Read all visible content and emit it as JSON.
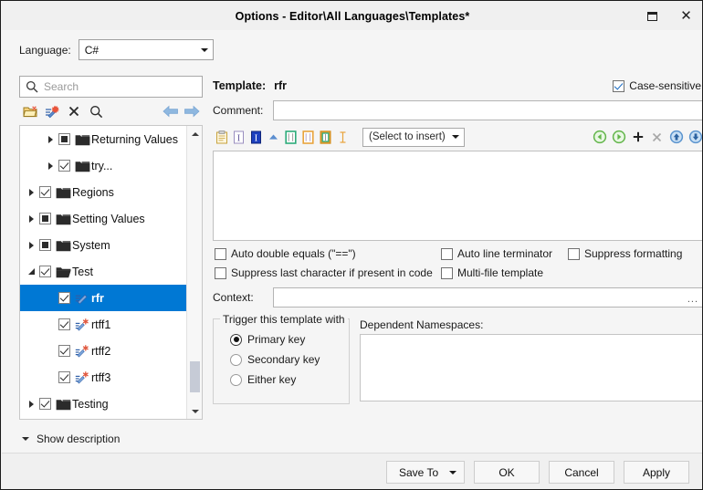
{
  "window": {
    "title": "Options - Editor\\All Languages\\Templates*",
    "restore_icon": "restore-icon",
    "close_icon": "close-icon"
  },
  "language": {
    "label": "Language:",
    "value": "C#"
  },
  "search": {
    "placeholder": "Search",
    "icon": "search-icon"
  },
  "tree_toolbar": {
    "buttons": [
      {
        "name": "new-folder-icon",
        "tooltip": "New folder"
      },
      {
        "name": "new-template-icon",
        "tooltip": "New template"
      },
      {
        "name": "delete-icon",
        "tooltip": "Delete"
      },
      {
        "name": "find-icon",
        "tooltip": "Find"
      }
    ],
    "nav": [
      {
        "name": "back-arrow-icon"
      },
      {
        "name": "forward-arrow-icon"
      }
    ]
  },
  "tree": {
    "items": [
      {
        "label": "Returning Values",
        "indent": 1,
        "expander": "collapsed",
        "check": "partial",
        "icon": "folder-icon",
        "selected": false
      },
      {
        "label": "try...",
        "indent": 1,
        "expander": "collapsed",
        "check": "checked",
        "icon": "folder-icon",
        "selected": false
      },
      {
        "label": "Regions",
        "indent": 0,
        "expander": "collapsed",
        "check": "checked",
        "icon": "folder-icon",
        "selected": false
      },
      {
        "label": "Setting Values",
        "indent": 0,
        "expander": "collapsed",
        "check": "partial",
        "icon": "folder-icon",
        "selected": false
      },
      {
        "label": "System",
        "indent": 0,
        "expander": "collapsed",
        "check": "partial",
        "icon": "folder-icon",
        "selected": false
      },
      {
        "label": "Test",
        "indent": 0,
        "expander": "expanded",
        "check": "checked",
        "icon": "folder-open-icon",
        "selected": false
      },
      {
        "label": "rfr",
        "indent": 1,
        "expander": "none",
        "check": "checked",
        "icon": "template-icon",
        "selected": true
      },
      {
        "label": "rtff1",
        "indent": 1,
        "expander": "none",
        "check": "checked",
        "icon": "template-new-icon",
        "selected": false
      },
      {
        "label": "rtff2",
        "indent": 1,
        "expander": "none",
        "check": "checked",
        "icon": "template-new-icon",
        "selected": false
      },
      {
        "label": "rtff3",
        "indent": 1,
        "expander": "none",
        "check": "checked",
        "icon": "template-new-icon",
        "selected": false
      },
      {
        "label": "Testing",
        "indent": 0,
        "expander": "collapsed",
        "check": "checked",
        "icon": "folder-icon",
        "selected": false
      }
    ],
    "scrollbar": {
      "up_icon": "scroll-up-icon",
      "down_icon": "scroll-down-icon"
    }
  },
  "template": {
    "label": "Template:",
    "name": "rfr",
    "case_sensitive": {
      "label": "Case-sensitive",
      "checked": true
    },
    "comment": {
      "label": "Comment:",
      "value": "",
      "placeholder": ""
    },
    "body": ""
  },
  "editor_toolbar": {
    "buttons": [
      {
        "name": "paste-icon"
      },
      {
        "name": "insert-variable-icon"
      },
      {
        "name": "insert-field-icon"
      },
      {
        "name": "caret-up-icon"
      },
      {
        "name": "editable-field-green-icon"
      },
      {
        "name": "editable-field-orange-icon"
      },
      {
        "name": "selected-field-icon"
      },
      {
        "name": "caret-position-icon"
      }
    ],
    "insert_combo": {
      "value": "(Select to insert)"
    },
    "right_buttons": [
      {
        "name": "nav-prev-icon"
      },
      {
        "name": "nav-next-icon"
      },
      {
        "name": "add-icon"
      },
      {
        "name": "remove-icon"
      },
      {
        "name": "move-up-icon"
      },
      {
        "name": "move-down-icon"
      }
    ]
  },
  "options": [
    {
      "label": "Auto double equals (\"==\")",
      "checked": false,
      "name": "auto-double-equals-checkbox",
      "col": 0,
      "row": 0
    },
    {
      "label": "Auto line terminator",
      "checked": false,
      "name": "auto-line-terminator-checkbox",
      "col": 1,
      "row": 0
    },
    {
      "label": "Suppress formatting",
      "checked": false,
      "name": "suppress-formatting-checkbox",
      "col": 2,
      "row": 0
    },
    {
      "label": "Suppress last character if present in code",
      "checked": false,
      "name": "suppress-last-character-checkbox",
      "col": 0,
      "row": 1
    },
    {
      "label": "Multi-file template",
      "checked": false,
      "name": "multi-file-template-checkbox",
      "col": 1,
      "row": 1
    }
  ],
  "context": {
    "label": "Context:",
    "value": "",
    "ellipsis": "..."
  },
  "trigger": {
    "title": "Trigger this template with",
    "options": [
      {
        "label": "Primary key",
        "selected": true
      },
      {
        "label": "Secondary key",
        "selected": false
      },
      {
        "label": "Either key",
        "selected": false
      }
    ]
  },
  "namespaces": {
    "title": "Dependent Namespaces:",
    "value": ""
  },
  "description": {
    "label": "Show description",
    "caret": "chevron-down-icon"
  },
  "footer": {
    "buttons": [
      {
        "label": "Save To",
        "name": "save-to-button",
        "split": true
      },
      {
        "label": "OK",
        "name": "ok-button",
        "split": false
      },
      {
        "label": "Cancel",
        "name": "cancel-button",
        "split": false
      },
      {
        "label": "Apply",
        "name": "apply-button",
        "split": false
      }
    ]
  },
  "colors": {
    "selection": "#0078d4",
    "window_bg": "#f5f5f5",
    "titlebar_bg": "#f0f0f0",
    "field_bg": "#ffffff"
  }
}
